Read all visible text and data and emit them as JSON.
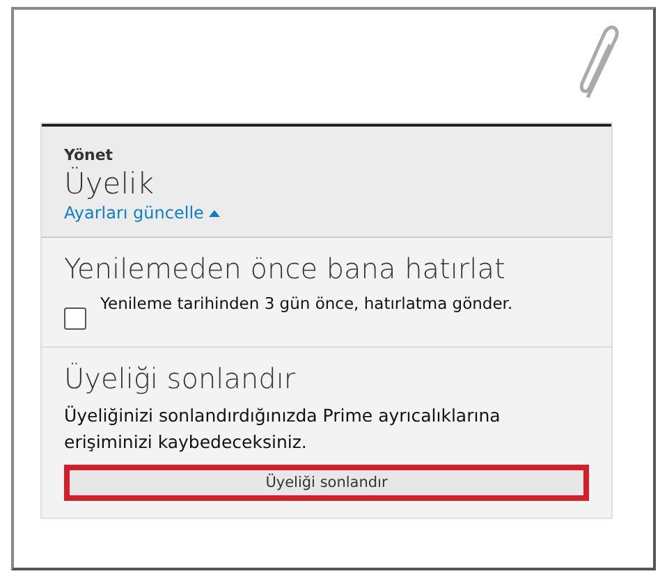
{
  "manage": {
    "label": "Yönet",
    "title": "Üyelik",
    "link": "Ayarları güncelle",
    "link_expanded": true
  },
  "reminder": {
    "heading": "Yenilemeden önce bana hatırlat",
    "option": {
      "label": "Yenileme tarihinden 3 gün önce, hatırlatma gönder.",
      "checked": false
    }
  },
  "end_membership": {
    "heading": "Üyeliği sonlandır",
    "description": "Üyeliğinizi sonlandırdığınızda Prime ayrıcalıklarına erişiminizi kaybedeceksiniz.",
    "button": "Üyeliği sonlandır",
    "highlighted": true
  }
}
